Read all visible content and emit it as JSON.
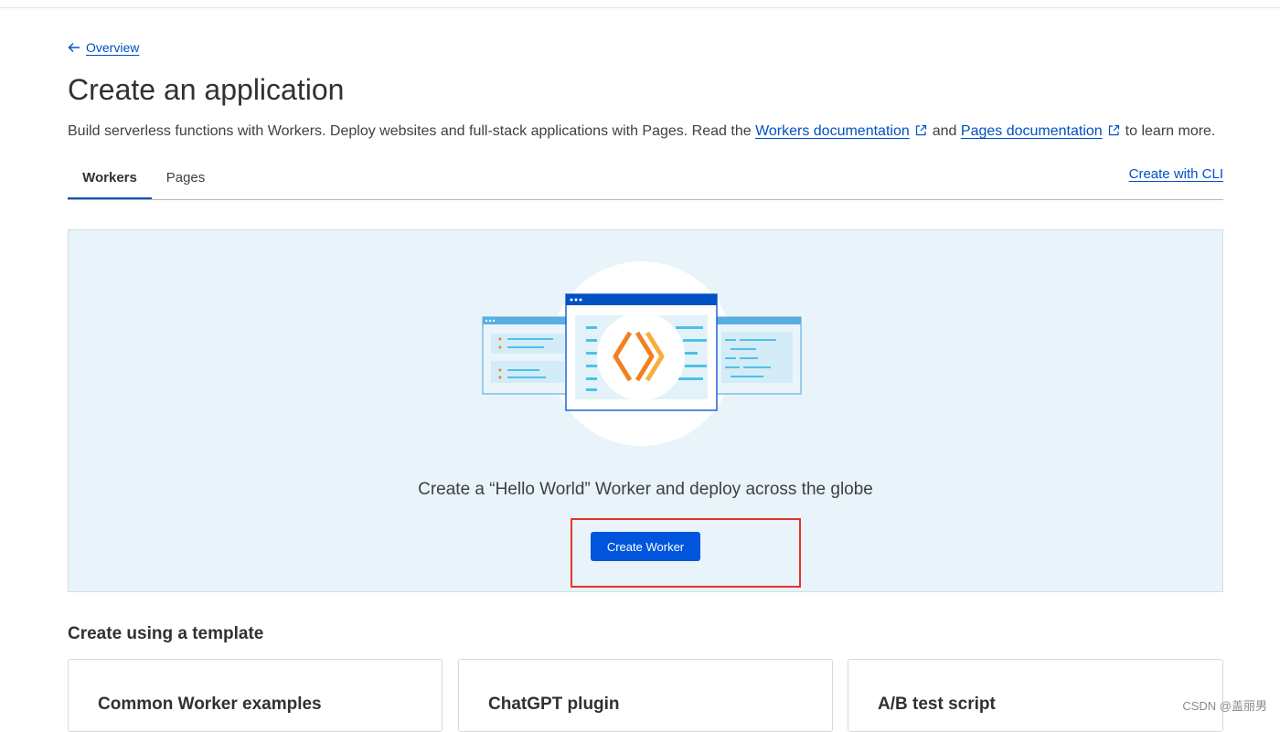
{
  "nav": {
    "back_label": "Overview"
  },
  "page": {
    "title": "Create an application",
    "intro": {
      "text_before": "Build serverless functions with Workers. Deploy websites and full-stack applications with Pages. Read the ",
      "workers_doc_link": "Workers documentation",
      "and": "and",
      "pages_doc_link": "Pages documentation",
      "text_after": "to learn more."
    }
  },
  "tabs": [
    {
      "label": "Workers",
      "active": true
    },
    {
      "label": "Pages",
      "active": false
    }
  ],
  "cli_link": "Create with CLI",
  "hero": {
    "text": "Create a “Hello World” Worker and deploy across the globe",
    "button_label": "Create Worker"
  },
  "templates": {
    "section_title": "Create using a template",
    "cards": [
      {
        "title": "Common Worker examples"
      },
      {
        "title": "ChatGPT plugin"
      },
      {
        "title": "A/B test script"
      }
    ]
  },
  "watermark": "CSDN @盖丽男",
  "colors": {
    "accent": "#0051c3",
    "primary_button": "#0055dc",
    "hero_bg": "#e8f4f9",
    "highlight": "#e5322d",
    "logo_orange": "#f38020"
  },
  "icons": {
    "back": "arrow-left-icon",
    "external": "external-link-icon",
    "illustration": "workers-illustration"
  }
}
